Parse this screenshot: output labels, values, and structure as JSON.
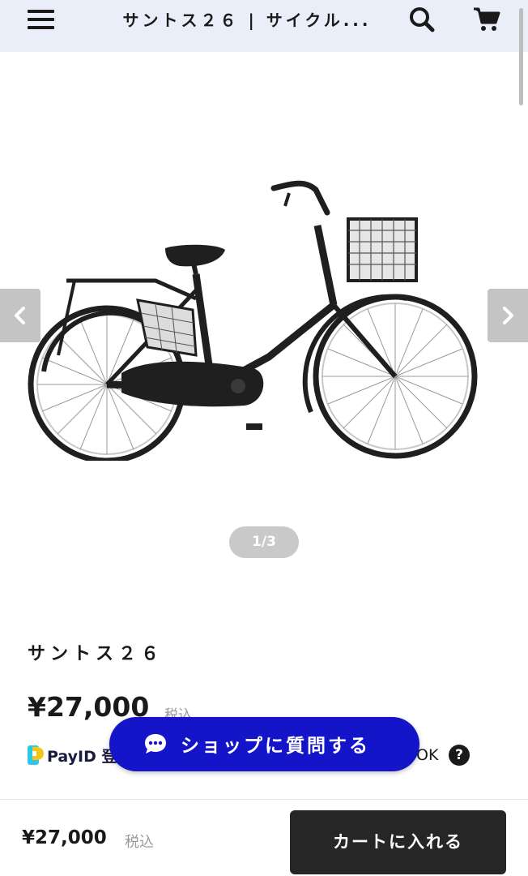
{
  "header": {
    "title": "サントス２６ | サイクル...",
    "menu_icon": "hamburger-menu-icon",
    "search_icon": "search-icon",
    "cart_icon": "cart-icon",
    "background": "#eaeef8"
  },
  "gallery": {
    "counter": "1/3",
    "current_index": 1,
    "total": 3,
    "prev_icon": "chevron-left-icon",
    "next_icon": "chevron-right-icon"
  },
  "product": {
    "name": "サントス２６",
    "price": "¥27,000",
    "tax_note": "税込"
  },
  "payid": {
    "logo": "payid-logo-icon",
    "label": "PayID 登",
    "trailing_text": "OK",
    "help_icon": "?"
  },
  "ask_shop": {
    "label": "ショップに質問する",
    "icon": "chat-bubble-icon",
    "color": "#1414c8"
  },
  "bottom_bar": {
    "price": "¥27,000",
    "tax_note": "税込",
    "add_to_cart_label": "カートに入れる",
    "button_color": "#262626"
  }
}
